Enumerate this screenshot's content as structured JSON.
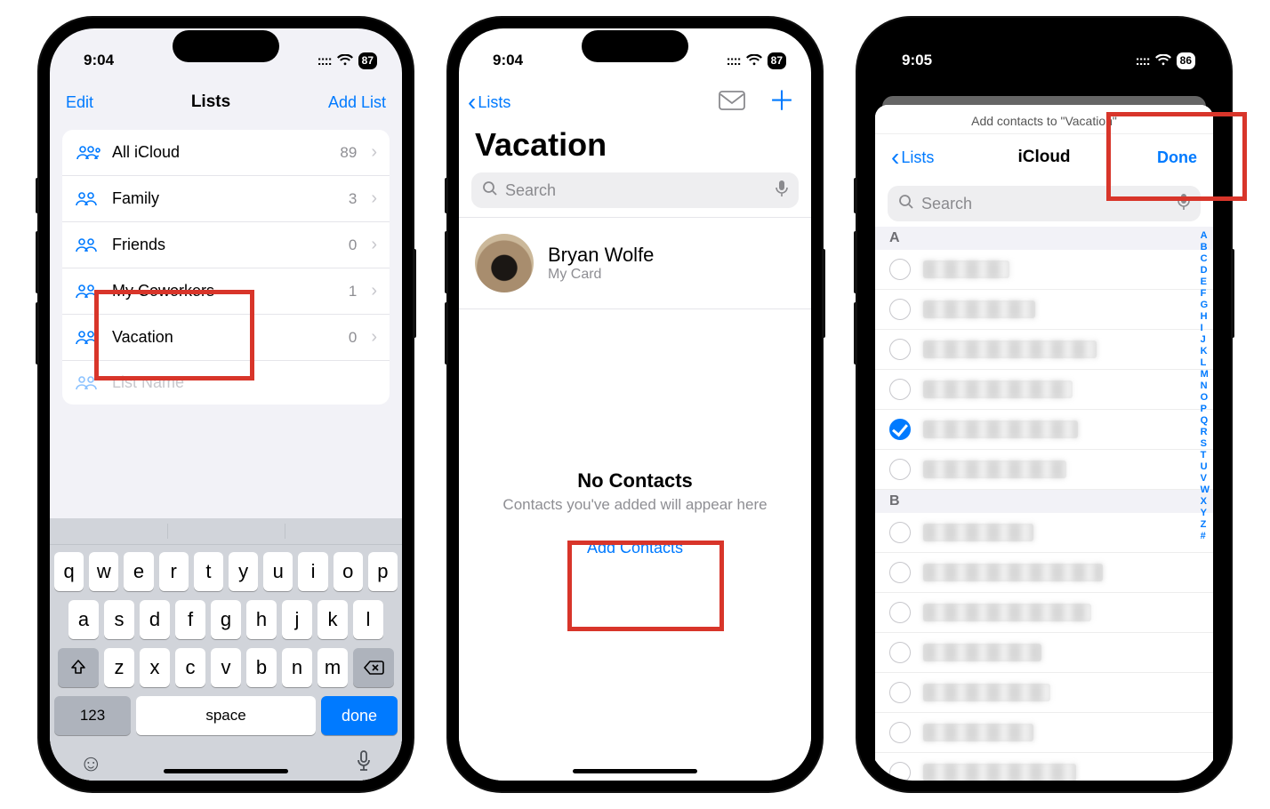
{
  "status": {
    "time1": "9:04",
    "time2": "9:04",
    "time3": "9:05",
    "battery1": "87",
    "battery2": "87",
    "battery3": "86"
  },
  "s1": {
    "edit": "Edit",
    "title": "Lists",
    "addList": "Add List",
    "rows": [
      {
        "name": "All iCloud",
        "count": "89"
      },
      {
        "name": "Family",
        "count": "3"
      },
      {
        "name": "Friends",
        "count": "0"
      },
      {
        "name": "My Coworkers",
        "count": "1"
      },
      {
        "name": "Vacation",
        "count": "0"
      }
    ],
    "placeholder": "List Name",
    "keys_r1": [
      "q",
      "w",
      "e",
      "r",
      "t",
      "y",
      "u",
      "i",
      "o",
      "p"
    ],
    "keys_r2": [
      "a",
      "s",
      "d",
      "f",
      "g",
      "h",
      "j",
      "k",
      "l"
    ],
    "keys_r3": [
      "z",
      "x",
      "c",
      "v",
      "b",
      "n",
      "m"
    ],
    "numKey": "123",
    "spaceKey": "space",
    "doneKey": "done"
  },
  "s2": {
    "back": "Lists",
    "title": "Vacation",
    "searchPlaceholder": "Search",
    "myName": "Bryan Wolfe",
    "mySub": "My Card",
    "emptyTitle": "No Contacts",
    "emptySub": "Contacts you've added will appear here",
    "emptyAction": "Add Contacts"
  },
  "s3": {
    "sheetTitle": "Add contacts to \"Vacation\"",
    "back": "Lists",
    "navTitle": "iCloud",
    "done": "Done",
    "searchPlaceholder": "Search",
    "sectionA": "A",
    "sectionB": "B",
    "rowsA": [
      false,
      false,
      false,
      false,
      true,
      false
    ],
    "rowsB": [
      false,
      false,
      false,
      false,
      false,
      false,
      false
    ],
    "indexLetters": [
      "A",
      "B",
      "C",
      "D",
      "E",
      "F",
      "G",
      "H",
      "I",
      "J",
      "K",
      "L",
      "M",
      "N",
      "O",
      "P",
      "Q",
      "R",
      "S",
      "T",
      "U",
      "V",
      "W",
      "X",
      "Y",
      "Z",
      "#"
    ]
  }
}
